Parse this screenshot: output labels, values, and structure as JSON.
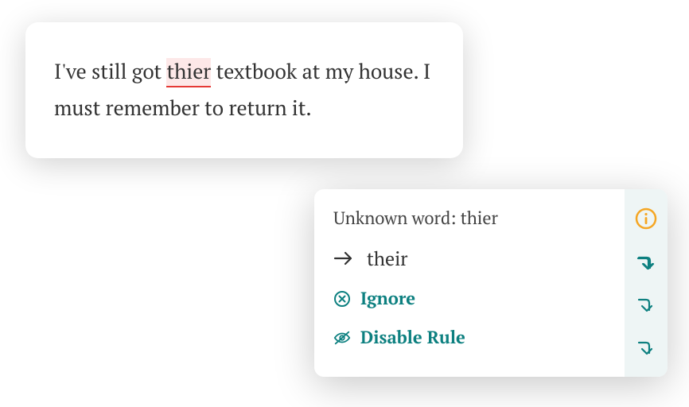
{
  "editor": {
    "text_before": "I've still got ",
    "misspelled_word": "thier",
    "text_after": " textbook at my house. I must remember to return it."
  },
  "popup": {
    "title": "Unknown word: thier",
    "suggestion": "their",
    "ignore_label": "Ignore",
    "disable_label": "Disable Rule"
  },
  "colors": {
    "teal": "#0d8080",
    "orange": "#f5a623",
    "error_underline": "#e53935",
    "error_bg": "#fde8e8"
  }
}
